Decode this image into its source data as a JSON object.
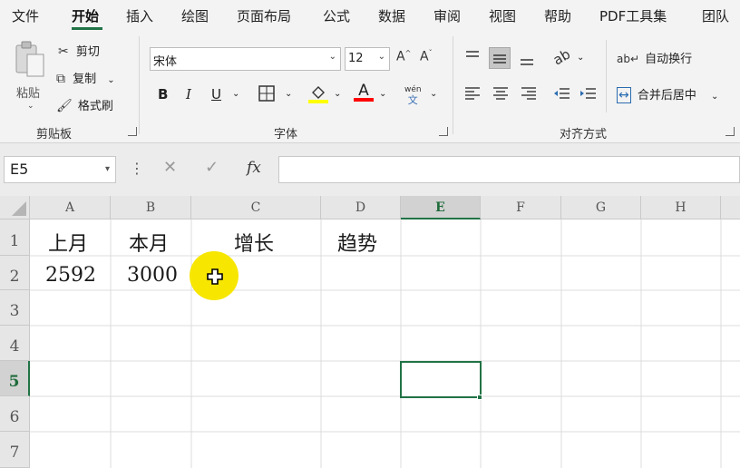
{
  "menu": {
    "tabs": [
      "文件",
      "开始",
      "插入",
      "绘图",
      "页面布局",
      "公式",
      "数据",
      "审阅",
      "视图",
      "帮助",
      "PDF工具集",
      "团队"
    ],
    "active_tab": "开始"
  },
  "ribbon": {
    "clipboard": {
      "paste_label": "粘贴",
      "cut_label": "剪切",
      "copy_label": "复制",
      "format_painter_label": "格式刷",
      "group_label": "剪贴板"
    },
    "font": {
      "font_name": "宋体",
      "font_size": "12",
      "bold": "B",
      "italic": "I",
      "underline": "U",
      "font_color_glyph": "A",
      "wen_top": "wén",
      "wen_bottom": "文",
      "group_label": "字体"
    },
    "alignment": {
      "wrap_text_label": "自动换行",
      "merge_center_label": "合并后居中",
      "group_label": "对齐方式"
    }
  },
  "formula_bar": {
    "name_box": "E5",
    "fx": "fx",
    "formula": ""
  },
  "sheet": {
    "columns": [
      "A",
      "B",
      "C",
      "D",
      "E",
      "F",
      "G",
      "H"
    ],
    "rows": [
      "1",
      "2",
      "3",
      "4",
      "5",
      "6",
      "7"
    ],
    "selected_column": "E",
    "selected_row": "5",
    "cells": {
      "A1": "上月",
      "B1": "本月",
      "C1": "增长",
      "D1": "趋势",
      "A2": "2592",
      "B2": "3000"
    }
  },
  "colors": {
    "accent": "#217346",
    "highlight_bar": "#ffff00",
    "font_color_bar": "#ff0000",
    "cursor_highlight": "#f7e600"
  }
}
